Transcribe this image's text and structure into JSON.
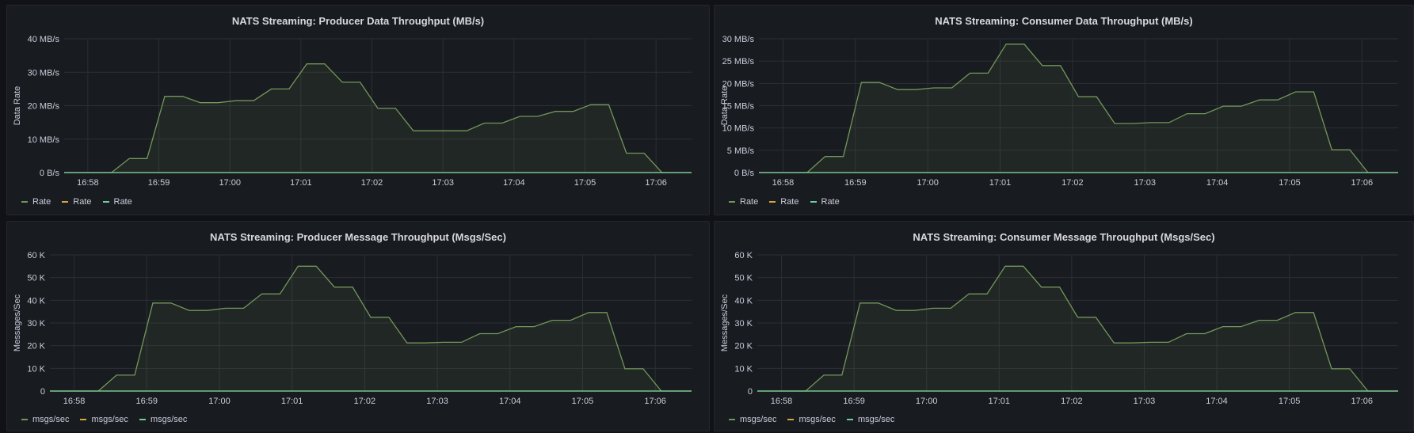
{
  "colors": {
    "series_green": "#73975b",
    "series_orange": "#e0a040",
    "series_teal": "#6ccf9e"
  },
  "panels": [
    {
      "title": "NATS Streaming: Producer Data Throughput (MB/s)",
      "legend": [
        {
          "label": "Rate",
          "color": "#73975b"
        },
        {
          "label": "Rate",
          "color": "#d9a441"
        },
        {
          "label": "Rate",
          "color": "#6ccf9e"
        }
      ]
    },
    {
      "title": "NATS Streaming: Consumer Data Throughput (MB/s)",
      "legend": [
        {
          "label": "Rate",
          "color": "#73975b"
        },
        {
          "label": "Rate",
          "color": "#d9a441"
        },
        {
          "label": "Rate",
          "color": "#6ccf9e"
        }
      ]
    },
    {
      "title": "NATS Streaming: Producer Message Throughput (Msgs/Sec)",
      "legend": [
        {
          "label": "msgs/sec",
          "color": "#73975b"
        },
        {
          "label": "msgs/sec",
          "color": "#d9a441"
        },
        {
          "label": "msgs/sec",
          "color": "#6ccf9e"
        }
      ]
    },
    {
      "title": "NATS Streaming: Consumer Message Throughput (Msgs/Sec)",
      "legend": [
        {
          "label": "msgs/sec",
          "color": "#73975b"
        },
        {
          "label": "msgs/sec",
          "color": "#d9a441"
        },
        {
          "label": "msgs/sec",
          "color": "#6ccf9e"
        }
      ]
    }
  ],
  "chart_data": [
    {
      "type": "area",
      "title": "NATS Streaming: Producer Data Throughput (MB/s)",
      "ylabel": "Data Rate",
      "xticks": [
        "16:58",
        "16:59",
        "17:00",
        "17:01",
        "17:02",
        "17:03",
        "17:04",
        "17:05",
        "17:06"
      ],
      "yticks": [
        "0 B/s",
        "10 MB/s",
        "20 MB/s",
        "30 MB/s",
        "40 MB/s"
      ],
      "ylim": [
        0,
        40
      ],
      "xlim": [
        "16:57:40",
        "17:06:30"
      ],
      "x": [
        "16:57:40",
        "16:58:20",
        "16:58:35",
        "16:58:50",
        "16:59:05",
        "16:59:20",
        "16:59:35",
        "16:59:50",
        "17:00:05",
        "17:00:20",
        "17:00:35",
        "17:00:50",
        "17:01:05",
        "17:01:20",
        "17:01:35",
        "17:01:50",
        "17:02:05",
        "17:02:20",
        "17:02:35",
        "17:02:50",
        "17:03:05",
        "17:03:20",
        "17:03:35",
        "17:03:50",
        "17:04:05",
        "17:04:20",
        "17:04:35",
        "17:04:50",
        "17:05:05",
        "17:05:20",
        "17:05:35",
        "17:05:50",
        "17:06:05",
        "17:06:30"
      ],
      "series": [
        {
          "values": [
            0,
            0,
            4.2,
            4.2,
            22.8,
            22.8,
            20.9,
            20.9,
            21.5,
            21.5,
            25.0,
            25.0,
            32.5,
            32.5,
            27.0,
            27.0,
            19.2,
            19.2,
            12.5,
            12.5,
            12.5,
            12.5,
            14.8,
            14.8,
            16.8,
            16.8,
            18.3,
            18.3,
            20.3,
            20.3,
            5.8,
            5.8,
            0,
            0
          ]
        },
        {
          "values": [
            0,
            0,
            0,
            0,
            0,
            0,
            0,
            0,
            0,
            0,
            0,
            0,
            0,
            0,
            0,
            0,
            0,
            0,
            0,
            0,
            0,
            0,
            0,
            0,
            0,
            0,
            0,
            0,
            0,
            0,
            0,
            0,
            0,
            0
          ]
        },
        {
          "values": [
            0,
            0,
            0,
            0,
            0,
            0,
            0,
            0,
            0,
            0,
            0,
            0,
            0,
            0,
            0,
            0,
            0,
            0,
            0,
            0,
            0,
            0,
            0,
            0,
            0,
            0,
            0,
            0,
            0,
            0,
            0,
            0,
            0,
            0
          ]
        }
      ]
    },
    {
      "type": "area",
      "title": "NATS Streaming: Consumer Data Throughput (MB/s)",
      "ylabel": "Data Rate",
      "xticks": [
        "16:58",
        "16:59",
        "17:00",
        "17:01",
        "17:02",
        "17:03",
        "17:04",
        "17:05",
        "17:06"
      ],
      "yticks": [
        "0 B/s",
        "5 MB/s",
        "10 MB/s",
        "15 MB/s",
        "20 MB/s",
        "25 MB/s",
        "30 MB/s"
      ],
      "ylim": [
        0,
        30
      ],
      "xlim": [
        "16:57:40",
        "17:06:30"
      ],
      "x": [
        "16:57:40",
        "16:58:20",
        "16:58:35",
        "16:58:50",
        "16:59:05",
        "16:59:20",
        "16:59:35",
        "16:59:50",
        "17:00:05",
        "17:00:20",
        "17:00:35",
        "17:00:50",
        "17:01:05",
        "17:01:20",
        "17:01:35",
        "17:01:50",
        "17:02:05",
        "17:02:20",
        "17:02:35",
        "17:02:50",
        "17:03:05",
        "17:03:20",
        "17:03:35",
        "17:03:50",
        "17:04:05",
        "17:04:20",
        "17:04:35",
        "17:04:50",
        "17:05:05",
        "17:05:20",
        "17:05:35",
        "17:05:50",
        "17:06:05",
        "17:06:30"
      ],
      "series": [
        {
          "values": [
            0,
            0,
            3.6,
            3.6,
            20.2,
            20.2,
            18.6,
            18.6,
            19.0,
            19.0,
            22.3,
            22.3,
            28.8,
            28.8,
            24.0,
            24.0,
            17.0,
            17.0,
            11.0,
            11.0,
            11.2,
            11.2,
            13.2,
            13.2,
            14.9,
            14.9,
            16.3,
            16.3,
            18.1,
            18.1,
            5.1,
            5.1,
            0,
            0
          ]
        },
        {
          "values": [
            0,
            0,
            0,
            0,
            0,
            0,
            0,
            0,
            0,
            0,
            0,
            0,
            0,
            0,
            0,
            0,
            0,
            0,
            0,
            0,
            0,
            0,
            0,
            0,
            0,
            0,
            0,
            0,
            0,
            0,
            0,
            0,
            0,
            0
          ]
        },
        {
          "values": [
            0,
            0,
            0,
            0,
            0,
            0,
            0,
            0,
            0,
            0,
            0,
            0,
            0,
            0,
            0,
            0,
            0,
            0,
            0,
            0,
            0,
            0,
            0,
            0,
            0,
            0,
            0,
            0,
            0,
            0,
            0,
            0,
            0,
            0
          ]
        }
      ]
    },
    {
      "type": "area",
      "title": "NATS Streaming: Producer Message Throughput (Msgs/Sec)",
      "ylabel": "Messages/Sec",
      "xticks": [
        "16:58",
        "16:59",
        "17:00",
        "17:01",
        "17:02",
        "17:03",
        "17:04",
        "17:05",
        "17:06"
      ],
      "yticks": [
        "0",
        "10 K",
        "20 K",
        "30 K",
        "40 K",
        "50 K",
        "60 K"
      ],
      "ylim": [
        0,
        60000
      ],
      "xlim": [
        "16:57:40",
        "17:06:30"
      ],
      "x": [
        "16:57:40",
        "16:58:20",
        "16:58:35",
        "16:58:50",
        "16:59:05",
        "16:59:20",
        "16:59:35",
        "16:59:50",
        "17:00:05",
        "17:00:20",
        "17:00:35",
        "17:00:50",
        "17:01:05",
        "17:01:20",
        "17:01:35",
        "17:01:50",
        "17:02:05",
        "17:02:20",
        "17:02:35",
        "17:02:50",
        "17:03:05",
        "17:03:20",
        "17:03:35",
        "17:03:50",
        "17:04:05",
        "17:04:20",
        "17:04:35",
        "17:04:50",
        "17:05:05",
        "17:05:20",
        "17:05:35",
        "17:05:50",
        "17:06:05",
        "17:06:30"
      ],
      "series": [
        {
          "values": [
            0,
            0,
            7000,
            7000,
            38800,
            38800,
            35500,
            35500,
            36500,
            36500,
            42800,
            42800,
            55000,
            55000,
            45800,
            45800,
            32500,
            32500,
            21200,
            21200,
            21500,
            21500,
            25300,
            25300,
            28400,
            28400,
            31200,
            31200,
            34600,
            34600,
            9800,
            9800,
            0,
            0
          ]
        },
        {
          "values": [
            0,
            0,
            0,
            0,
            0,
            0,
            0,
            0,
            0,
            0,
            0,
            0,
            0,
            0,
            0,
            0,
            0,
            0,
            0,
            0,
            0,
            0,
            0,
            0,
            0,
            0,
            0,
            0,
            0,
            0,
            0,
            0,
            0,
            0
          ]
        },
        {
          "values": [
            0,
            0,
            0,
            0,
            0,
            0,
            0,
            0,
            0,
            0,
            0,
            0,
            0,
            0,
            0,
            0,
            0,
            0,
            0,
            0,
            0,
            0,
            0,
            0,
            0,
            0,
            0,
            0,
            0,
            0,
            0,
            0,
            0,
            0
          ]
        }
      ]
    },
    {
      "type": "area",
      "title": "NATS Streaming: Consumer Message Throughput (Msgs/Sec)",
      "ylabel": "Messages/Sec",
      "xticks": [
        "16:58",
        "16:59",
        "17:00",
        "17:01",
        "17:02",
        "17:03",
        "17:04",
        "17:05",
        "17:06"
      ],
      "yticks": [
        "0",
        "10 K",
        "20 K",
        "30 K",
        "40 K",
        "50 K",
        "60 K"
      ],
      "ylim": [
        0,
        60000
      ],
      "xlim": [
        "16:57:40",
        "17:06:30"
      ],
      "x": [
        "16:57:40",
        "16:58:20",
        "16:58:35",
        "16:58:50",
        "16:59:05",
        "16:59:20",
        "16:59:35",
        "16:59:50",
        "17:00:05",
        "17:00:20",
        "17:00:35",
        "17:00:50",
        "17:01:05",
        "17:01:20",
        "17:01:35",
        "17:01:50",
        "17:02:05",
        "17:02:20",
        "17:02:35",
        "17:02:50",
        "17:03:05",
        "17:03:20",
        "17:03:35",
        "17:03:50",
        "17:04:05",
        "17:04:20",
        "17:04:35",
        "17:04:50",
        "17:05:05",
        "17:05:20",
        "17:05:35",
        "17:05:50",
        "17:06:05",
        "17:06:30"
      ],
      "series": [
        {
          "values": [
            0,
            0,
            7000,
            7000,
            38800,
            38800,
            35500,
            35500,
            36500,
            36500,
            42800,
            42800,
            55000,
            55000,
            45800,
            45800,
            32500,
            32500,
            21200,
            21200,
            21500,
            21500,
            25300,
            25300,
            28400,
            28400,
            31200,
            31200,
            34600,
            34600,
            9800,
            9800,
            0,
            0
          ]
        },
        {
          "values": [
            0,
            0,
            0,
            0,
            0,
            0,
            0,
            0,
            0,
            0,
            0,
            0,
            0,
            0,
            0,
            0,
            0,
            0,
            0,
            0,
            0,
            0,
            0,
            0,
            0,
            0,
            0,
            0,
            0,
            0,
            0,
            0,
            0,
            0
          ]
        },
        {
          "values": [
            0,
            0,
            0,
            0,
            0,
            0,
            0,
            0,
            0,
            0,
            0,
            0,
            0,
            0,
            0,
            0,
            0,
            0,
            0,
            0,
            0,
            0,
            0,
            0,
            0,
            0,
            0,
            0,
            0,
            0,
            0,
            0,
            0,
            0
          ]
        }
      ]
    }
  ]
}
